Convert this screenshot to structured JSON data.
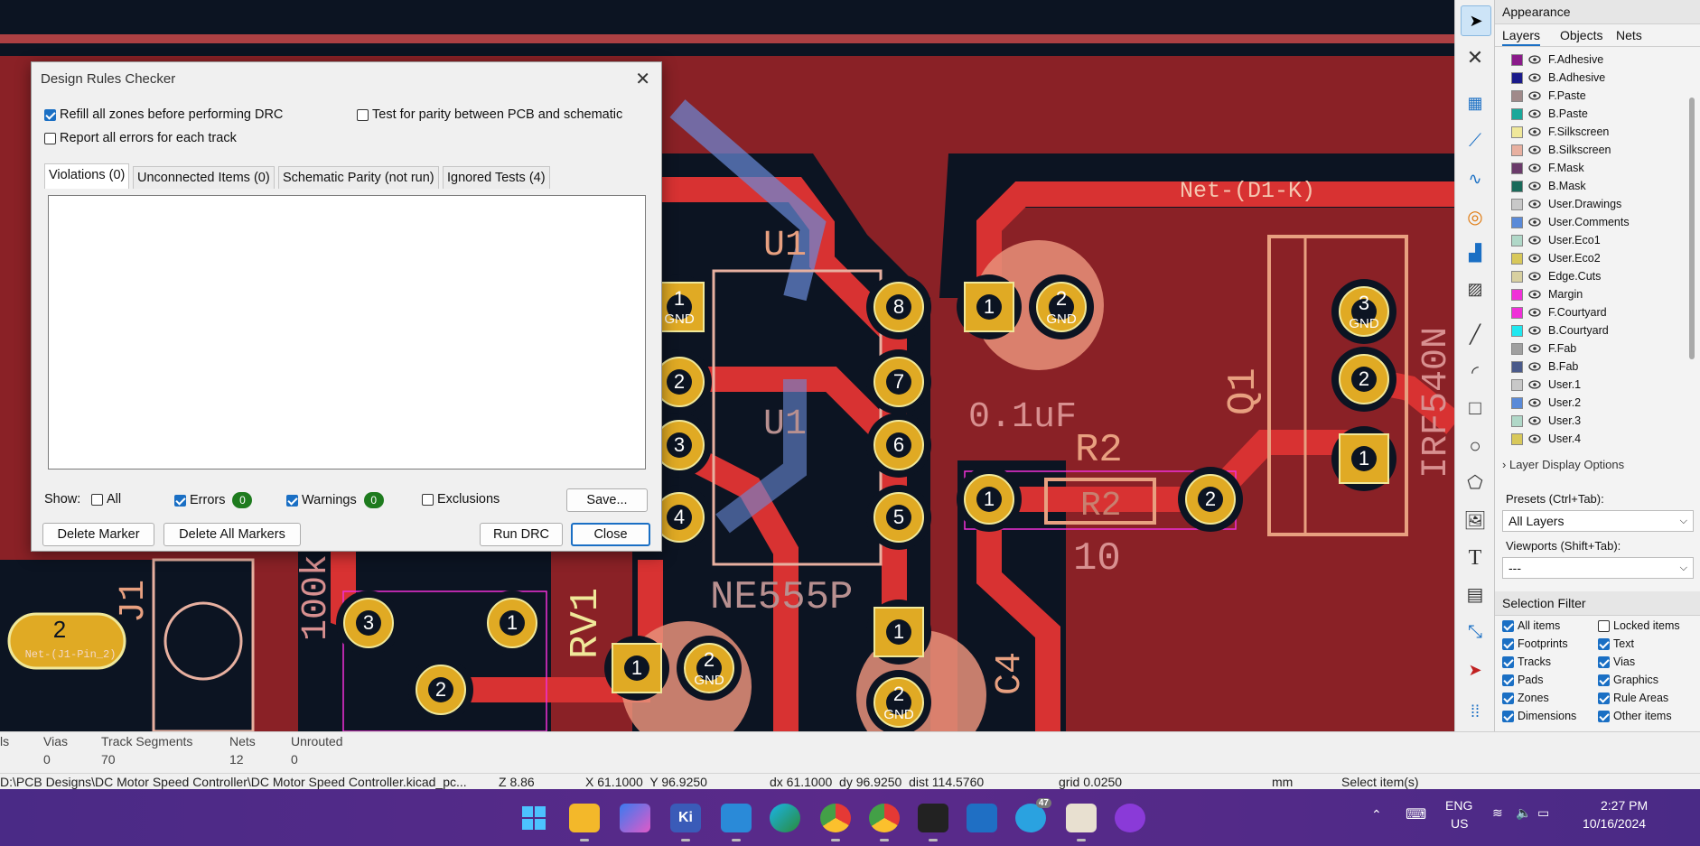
{
  "dialog": {
    "title": "Design Rules Checker",
    "refill_zones": "Refill all zones before performing DRC",
    "refill_zones_checked": true,
    "test_parity": "Test for parity between PCB and schematic",
    "test_parity_checked": false,
    "report_all": "Report all errors for each track",
    "report_all_checked": false,
    "tabs": [
      "Violations (0)",
      "Unconnected Items (0)",
      "Schematic Parity (not run)",
      "Ignored Tests (4)"
    ],
    "show_label": "Show:",
    "show_all": "All",
    "show_errors": "Errors",
    "errors_count": "0",
    "show_warnings": "Warnings",
    "warnings_count": "0",
    "show_exclusions": "Exclusions",
    "save_button": "Save...",
    "delete_marker": "Delete Marker",
    "delete_all_markers": "Delete All Markers",
    "run_drc": "Run DRC",
    "close": "Close"
  },
  "appearance": {
    "title": "Appearance",
    "tabs": [
      "Layers",
      "Objects",
      "Nets"
    ],
    "layers": [
      {
        "name": "F.Adhesive",
        "color": "#8a1a8a"
      },
      {
        "name": "B.Adhesive",
        "color": "#1a1a8a"
      },
      {
        "name": "F.Paste",
        "color": "#a08a8a"
      },
      {
        "name": "B.Paste",
        "color": "#1aa89a"
      },
      {
        "name": "F.Silkscreen",
        "color": "#f0e89a"
      },
      {
        "name": "B.Silkscreen",
        "color": "#e8b0a0"
      },
      {
        "name": "F.Mask",
        "color": "#6a3a6a"
      },
      {
        "name": "B.Mask",
        "color": "#1a6a5a"
      },
      {
        "name": "User.Drawings",
        "color": "#c8c8c8"
      },
      {
        "name": "User.Comments",
        "color": "#5a8ad8"
      },
      {
        "name": "User.Eco1",
        "color": "#b0d8c8"
      },
      {
        "name": "User.Eco2",
        "color": "#d8c85a"
      },
      {
        "name": "Edge.Cuts",
        "color": "#d8d0a0"
      },
      {
        "name": "Margin",
        "color": "#f030d8"
      },
      {
        "name": "F.Courtyard",
        "color": "#f030d8"
      },
      {
        "name": "B.Courtyard",
        "color": "#20e8f0"
      },
      {
        "name": "F.Fab",
        "color": "#a0a0a0"
      },
      {
        "name": "B.Fab",
        "color": "#4a5a8a"
      },
      {
        "name": "User.1",
        "color": "#c8c8c8"
      },
      {
        "name": "User.2",
        "color": "#5a8ad8"
      },
      {
        "name": "User.3",
        "color": "#b0d8c8"
      },
      {
        "name": "User.4",
        "color": "#d8c85a"
      }
    ],
    "layer_display_options": "Layer Display Options",
    "presets_label": "Presets (Ctrl+Tab):",
    "presets_value": "All Layers",
    "viewports_label": "Viewports (Shift+Tab):",
    "viewports_value": "---"
  },
  "selection_filter": {
    "title": "Selection Filter",
    "items": [
      {
        "label": "All items",
        "checked": true
      },
      {
        "label": "Locked items",
        "checked": false
      },
      {
        "label": "Footprints",
        "checked": true
      },
      {
        "label": "Text",
        "checked": true
      },
      {
        "label": "Tracks",
        "checked": true
      },
      {
        "label": "Vias",
        "checked": true
      },
      {
        "label": "Pads",
        "checked": true
      },
      {
        "label": "Graphics",
        "checked": true
      },
      {
        "label": "Zones",
        "checked": true
      },
      {
        "label": "Rule Areas",
        "checked": true
      },
      {
        "label": "Dimensions",
        "checked": true
      },
      {
        "label": "Other items",
        "checked": true
      }
    ]
  },
  "stats": [
    {
      "label": "ls",
      "value": ""
    },
    {
      "label": "Vias",
      "value": "0"
    },
    {
      "label": "Track Segments",
      "value": "70"
    },
    {
      "label": "Nets",
      "value": "12"
    },
    {
      "label": "Unrouted",
      "value": "0"
    }
  ],
  "status": {
    "path": "D:\\PCB Designs\\DC Motor Speed Controller\\DC Motor Speed Controller.kicad_pc...",
    "zoom": "Z 8.86",
    "xy": "X 61.1000  Y 96.9250",
    "delta": "dx 61.1000  dy 96.9250  dist 114.5760",
    "grid": "grid 0.0250",
    "units": "mm",
    "mode": "Select item(s)"
  },
  "canvas": {
    "net_label": "Net-(D1-K)",
    "labels": {
      "u1": "U1",
      "u1_top": "U1",
      "cap_value": "0.1uF",
      "r2_ref": "R2",
      "r2_body": "R2",
      "r2_value": "10",
      "ne555": "NE555P",
      "rv1": "RV1",
      "q1": "Q1",
      "irf": "IRF540N",
      "c4": "C4",
      "r100k": "100k",
      "j1": "J1",
      "net_j1": "Net-(J1-Pin_2)"
    },
    "pads": {
      "p1": "1",
      "p2": "2",
      "p3": "3",
      "p4": "4",
      "p5": "5",
      "p6": "6",
      "p7": "7",
      "p8": "8",
      "gnd": "GND"
    }
  },
  "taskbar": {
    "lang": "ENG",
    "region": "US",
    "time": "2:27 PM",
    "date": "10/16/2024",
    "kicad_label": "Ki",
    "badge": "47"
  }
}
